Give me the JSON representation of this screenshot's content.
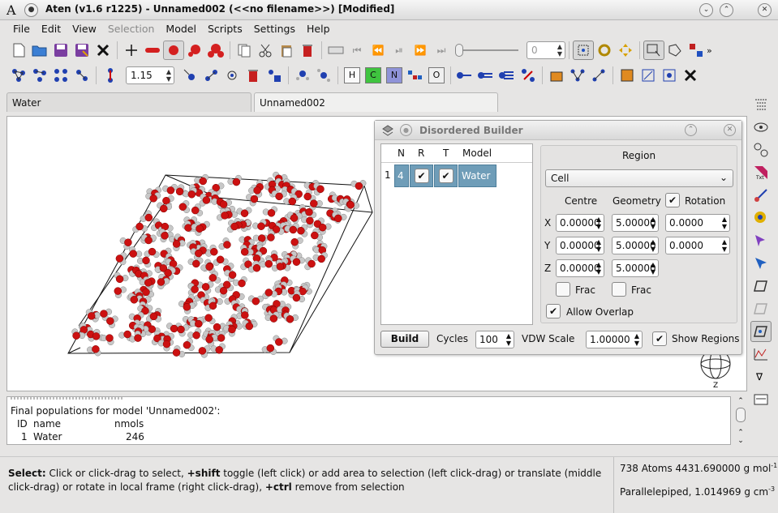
{
  "window": {
    "title": "Aten (v1.6 r1225) - Unnamed002 (<<no filename>>) [Modified]"
  },
  "menu": [
    "File",
    "Edit",
    "View",
    "Selection",
    "Model",
    "Scripts",
    "Settings",
    "Help"
  ],
  "toolbar": {
    "frame_value": "0",
    "scale_value": "1.15",
    "element_buttons": [
      "H",
      "C",
      "N",
      "O"
    ]
  },
  "tabs": [
    {
      "label": "Water"
    },
    {
      "label": "Unnamed002"
    }
  ],
  "builder": {
    "title": "Disordered Builder",
    "columns": [
      "N",
      "R",
      "T",
      "Model"
    ],
    "row": {
      "index": "1",
      "n": "4",
      "model": "Water"
    },
    "region_label": "Region",
    "region_value": "Cell",
    "centre_label": "Centre",
    "geometry_label": "Geometry",
    "rotation_label": "Rotation",
    "axes": [
      "X",
      "Y",
      "Z"
    ],
    "centre": [
      "0.00000",
      "0.00000",
      "0.00000"
    ],
    "geometry": [
      "5.00000",
      "5.00000",
      "5.00000"
    ],
    "rotation": [
      "0.0000",
      "0.0000"
    ],
    "frac_label": "Frac",
    "allow_overlap_label": "Allow Overlap",
    "build_label": "Build",
    "cycles_label": "Cycles",
    "cycles_value": "100",
    "vdw_label": "VDW Scale",
    "vdw_value": "1.00000",
    "show_regions_label": "Show Regions"
  },
  "console": {
    "lines": [
      "Final populations for model 'Unnamed002':"
    ],
    "header": {
      "id": "ID",
      "name": "name",
      "nmols": "nmols"
    },
    "rows": [
      {
        "id": "1",
        "name": "Water",
        "nmols": "246"
      }
    ]
  },
  "status": {
    "select_label": "Select:",
    "help_a": " Click or click-drag to select, ",
    "key_shift": "+shift",
    "help_b": " toggle (left click) or add area to selection (left click-drag) or translate (middle click-drag) or rotate in local frame (right click-drag), ",
    "key_ctrl": "+ctrl",
    "help_c": " remove from selection",
    "atoms": "738 Atoms 4431.690000 g mol",
    "atoms_sup": "-1",
    "cell": "Parallelepiped, 1.014969 g cm",
    "cell_sup": "-3"
  },
  "colors": {
    "oxygen": "#cc1111",
    "hydrogen": "#c8c8c8",
    "selection_blue": "#6f9db8"
  }
}
